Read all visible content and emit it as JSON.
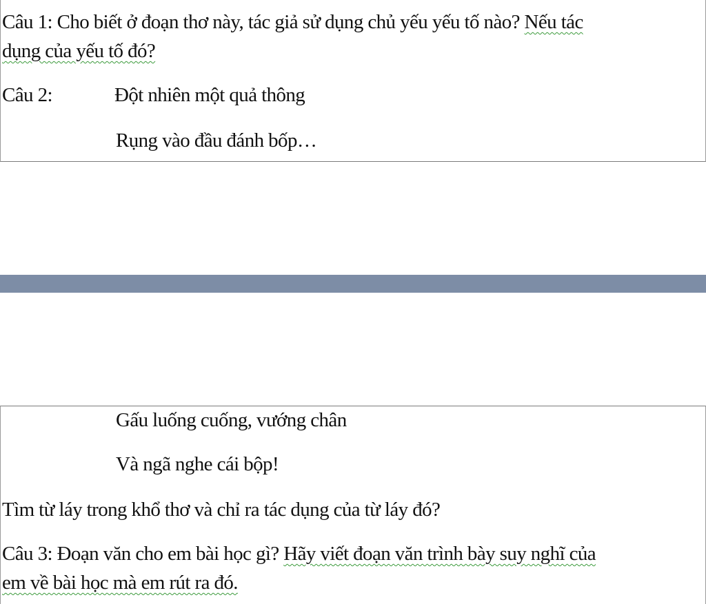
{
  "top_block": {
    "q1_line1_a": "Câu 1: Cho biết ở đoạn thơ này, tác giả sử dụng chủ yếu yếu tố nào? ",
    "q1_line1_b": "Nếu tác",
    "q1_line2": "dụng của yếu tố đó?",
    "q2_label": "Câu 2:",
    "poem_line1": "Đột nhiên một quả thông",
    "poem_line2": "Rụng vào đầu đánh bốp…"
  },
  "bottom_block": {
    "poem_line3": "Gấu luống cuống, vướng chân",
    "poem_line4": "Và ngã nghe cái bộp!",
    "q2_question": "Tìm từ láy trong khổ thơ và chỉ ra tác dụng của từ láy đó?",
    "q3_line1_a": "Câu 3: Đoạn văn cho em bài học gì? ",
    "q3_line1_b": "Hãy viết đoạn văn trình bày suy nghĩ của",
    "q3_line2": "em về bài học mà em rút ra đó."
  },
  "colors": {
    "separator": "#7d8da6",
    "border": "#7a7a7a",
    "squiggle": "#3b9a3b"
  }
}
